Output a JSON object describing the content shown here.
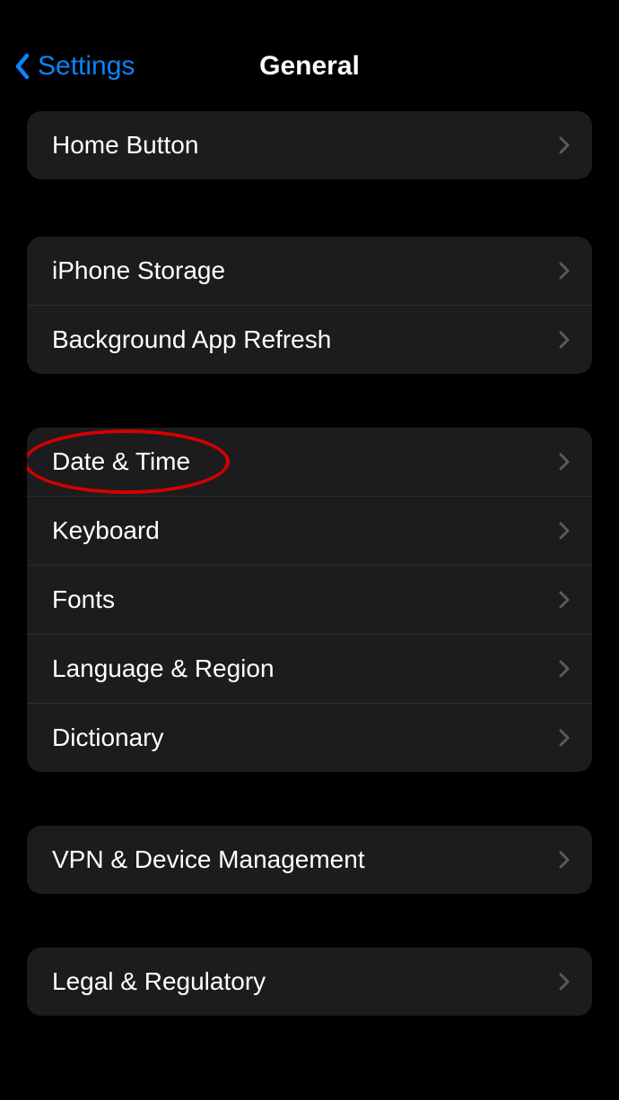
{
  "navbar": {
    "back_label": "Settings",
    "title": "General"
  },
  "groups": [
    {
      "id": "g0",
      "rows": [
        {
          "id": "home-button",
          "label": "Home Button"
        }
      ]
    },
    {
      "id": "g1",
      "rows": [
        {
          "id": "iphone-storage",
          "label": "iPhone Storage"
        },
        {
          "id": "background-app-refresh",
          "label": "Background App Refresh"
        }
      ]
    },
    {
      "id": "g2",
      "rows": [
        {
          "id": "date-time",
          "label": "Date & Time",
          "highlight": true
        },
        {
          "id": "keyboard",
          "label": "Keyboard"
        },
        {
          "id": "fonts",
          "label": "Fonts"
        },
        {
          "id": "language-region",
          "label": "Language & Region"
        },
        {
          "id": "dictionary",
          "label": "Dictionary"
        }
      ]
    },
    {
      "id": "g3",
      "rows": [
        {
          "id": "vpn-device-management",
          "label": "VPN & Device Management"
        }
      ]
    },
    {
      "id": "g4",
      "rows": [
        {
          "id": "legal-regulatory",
          "label": "Legal & Regulatory"
        }
      ]
    }
  ]
}
